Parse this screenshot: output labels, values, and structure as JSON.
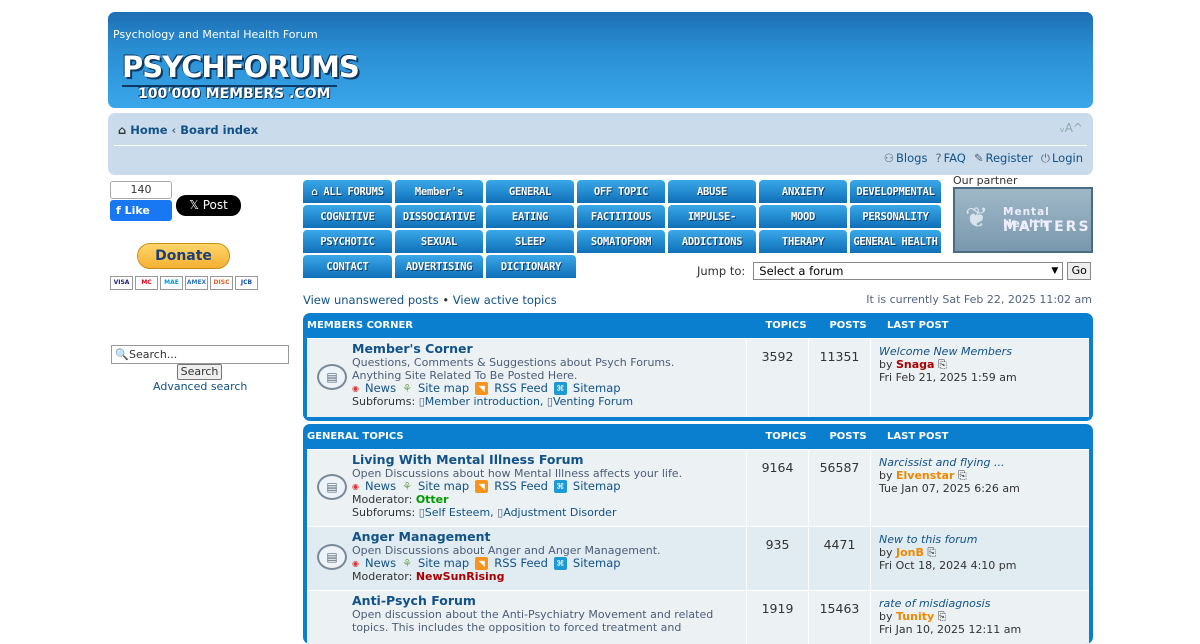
{
  "header": {
    "site_description": "Psychology and Mental Health Forum",
    "logo_text": "PSYCHFORUMS",
    "logo_subtext": "100'000 MEMBERS .COM"
  },
  "navbar": {
    "crumb_home": "Home",
    "crumb_sep": "‹",
    "crumb_board": "Board index",
    "font_size_icon": "font-size-icon",
    "links": {
      "blogs": "Blogs",
      "faq": "FAQ",
      "register": "Register",
      "login": "Login"
    }
  },
  "social": {
    "fb_count": "140",
    "fb_like": "Like",
    "x_post": "Post",
    "donate": "Donate",
    "cards": [
      "VISA",
      "MC",
      "MAE",
      "AMEX",
      "DISC",
      "JCB"
    ]
  },
  "search": {
    "placeholder": "Search...",
    "button": "Search",
    "advanced": "Advanced search"
  },
  "forum_tabs": [
    "ALL FORUMS",
    "Member's CORNER",
    "GENERAL",
    "OFF TOPIC",
    "ABUSE",
    "ANXIETY",
    "DEVELOPMENTAL",
    "COGNITIVE",
    "DISSOCIATIVE",
    "EATING",
    "FACTITIOUS",
    "IMPULSE-CONTROL",
    "MOOD",
    "PERSONALITY",
    "PSYCHOTIC",
    "SEXUAL",
    "SLEEP",
    "SOMATOFORM",
    "ADDICTIONS",
    "THERAPY",
    "GENERAL HEALTH",
    "CONTACT",
    "ADVERTISING",
    "DICTIONARY"
  ],
  "partner": {
    "label": "Our partner",
    "line1": "Mental Health",
    "line2": "MATTERS"
  },
  "jump": {
    "label": "Jump to:",
    "selected": "Select a forum",
    "go": "Go"
  },
  "quicklinks": {
    "unanswered": "View unanswered posts",
    "sep": "•",
    "active": "View active topics",
    "current_time": "It is currently Sat Feb 22, 2025 11:02 am"
  },
  "columns": {
    "topics": "TOPICS",
    "posts": "POSTS",
    "last_post": "LAST POST"
  },
  "categories": [
    {
      "name": "MEMBERS CORNER",
      "forums": [
        {
          "title": "Member's Corner",
          "desc1": "Questions, Comments & Suggestions about Psych Forums.",
          "desc2": "Anything Site Related To Be Posted Here.",
          "topics": "3592",
          "posts": "11351",
          "last_title": "Welcome New Members",
          "last_by": "by",
          "last_user": "Snaga",
          "last_date": "Fri Feb 21, 2025 1:59 am",
          "subforums_label": "Subforums:",
          "subforums": [
            "Member introduction,",
            "Venting Forum"
          ]
        }
      ]
    },
    {
      "name": "GENERAL TOPICS",
      "forums": [
        {
          "title": "Living With Mental Illness Forum",
          "desc1": "Open Discussions about how Mental Illness affects your life.",
          "moderator_label": "Moderator:",
          "moderator": "Otter",
          "topics": "9164",
          "posts": "56587",
          "last_title": "Narcissist and flying ...",
          "last_by": "by",
          "last_user": "Elvenstar",
          "last_date": "Tue Jan 07, 2025 6:26 am",
          "subforums_label": "Subforums:",
          "subforums": [
            "Self Esteem,",
            "Adjustment Disorder"
          ]
        },
        {
          "title": "Anger Management",
          "desc1": "Open Discussions about Anger and Anger Management.",
          "moderator_label": "Moderator:",
          "moderator": "NewSunRising",
          "topics": "935",
          "posts": "4471",
          "last_title": "New to this forum",
          "last_by": "by",
          "last_user": "JonB",
          "last_date": "Fri Oct 18, 2024 4:10 pm"
        },
        {
          "title": "Anti-Psych Forum",
          "desc1": "Open discussion about the Anti-Psychiatry Movement and related",
          "desc2": "topics. This includes the opposition to forced treatment and",
          "topics": "1919",
          "posts": "15463",
          "last_title": "rate of misdiagnosis",
          "last_by": "by",
          "last_user": "Tunity",
          "last_date": "Fri Jan 10, 2025 12:11 am"
        }
      ]
    }
  ],
  "forum_links": {
    "news": "News",
    "sitemap": "Site map",
    "rss": "RSS Feed",
    "sitemap2": "Sitemap"
  },
  "colors": {
    "header_blue": "#2a8fd4",
    "navbar_bg": "#cadceb",
    "forum_head": "#0a7fd0",
    "row_bg": "#ecf1f3",
    "link": "#105289"
  }
}
